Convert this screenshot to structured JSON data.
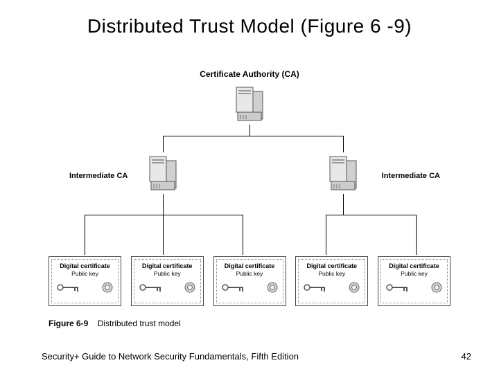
{
  "title": "Distributed Trust Model (Figure 6 -9)",
  "labels": {
    "ca": "Certificate Authority (CA)",
    "intermediate_left": "Intermediate CA",
    "intermediate_right": "Intermediate CA"
  },
  "certificate": {
    "title": "Digital certificate",
    "subtitle": "Public key"
  },
  "certificates_count": 5,
  "figure": {
    "number": "Figure 6-9",
    "caption": "Distributed trust model"
  },
  "footer": {
    "book": "Security+ Guide to Network Security Fundamentals, Fifth Edition",
    "page": "42"
  }
}
